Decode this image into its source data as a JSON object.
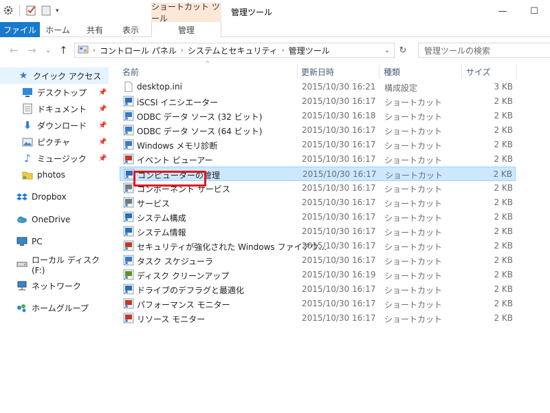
{
  "titlebar": {
    "context_tab": "ショートカット ツール",
    "window_title": "管理ツール",
    "minimize": "—",
    "maximize": "☐"
  },
  "ribbon": {
    "tabs": [
      "ファイル",
      "ホーム",
      "共有",
      "表示"
    ],
    "context_tab": "管理"
  },
  "nav": {
    "back": "←",
    "forward": "→",
    "dropdown": "⌄",
    "up": "↑",
    "breadcrumb": [
      "コントロール パネル",
      "システムとセキュリティ",
      "管理ツール"
    ],
    "search_placeholder": "管理ツールの検索"
  },
  "sidebar": {
    "items": [
      {
        "label": "クイック アクセス",
        "icon": "star-icon",
        "selected": true
      },
      {
        "label": "デスクトップ",
        "icon": "desktop-icon",
        "pinned": true
      },
      {
        "label": "ドキュメント",
        "icon": "documents-icon",
        "pinned": true
      },
      {
        "label": "ダウンロード",
        "icon": "download-icon",
        "pinned": true
      },
      {
        "label": "ピクチャ",
        "icon": "pictures-icon",
        "pinned": true
      },
      {
        "label": "ミュージック",
        "icon": "music-icon",
        "pinned": true
      },
      {
        "label": "photos",
        "icon": "folder-icon",
        "pinned": false
      },
      {
        "label": "Dropbox",
        "icon": "dropbox-icon"
      },
      {
        "label": "OneDrive",
        "icon": "onedrive-icon"
      },
      {
        "label": "PC",
        "icon": "pc-icon"
      },
      {
        "label": "ローカル ディスク (F:)",
        "icon": "drive-icon"
      },
      {
        "label": "ネットワーク",
        "icon": "network-icon"
      },
      {
        "label": "ホームグループ",
        "icon": "homegroup-icon"
      }
    ]
  },
  "columns": {
    "name": "名前",
    "modified": "更新日時",
    "type": "種類",
    "size": "サイズ"
  },
  "files": [
    {
      "name": "desktop.ini",
      "modified": "2015/10/30 16:21",
      "type": "構成設定",
      "size": "3 KB"
    },
    {
      "name": "iSCSI イニシエーター",
      "modified": "2015/10/30 16:17",
      "type": "ショートカット",
      "size": "2 KB"
    },
    {
      "name": "ODBC データ ソース (32 ビット)",
      "modified": "2015/10/30 16:18",
      "type": "ショートカット",
      "size": "2 KB"
    },
    {
      "name": "ODBC データ ソース (64 ビット)",
      "modified": "2015/10/30 16:17",
      "type": "ショートカット",
      "size": "2 KB"
    },
    {
      "name": "Windows メモリ診断",
      "modified": "2015/10/30 16:17",
      "type": "ショートカット",
      "size": "2 KB"
    },
    {
      "name": "イベント ビューアー",
      "modified": "2015/10/30 16:17",
      "type": "ショートカット",
      "size": "2 KB"
    },
    {
      "name": "コンピューターの管理",
      "modified": "2015/10/30 16:17",
      "type": "ショートカット",
      "size": "2 KB"
    },
    {
      "name": "コンポーネント サービス",
      "modified": "2015/10/30 16:17",
      "type": "ショートカット",
      "size": "2 KB"
    },
    {
      "name": "サービス",
      "modified": "2015/10/30 16:17",
      "type": "ショートカット",
      "size": "2 KB"
    },
    {
      "name": "システム構成",
      "modified": "2015/10/30 16:17",
      "type": "ショートカット",
      "size": "2 KB"
    },
    {
      "name": "システム情報",
      "modified": "2015/10/30 16:17",
      "type": "ショートカット",
      "size": "2 KB"
    },
    {
      "name": "セキュリティが強化された Windows ファイアウ...",
      "modified": "2015/10/30 16:17",
      "type": "ショートカット",
      "size": "2 KB"
    },
    {
      "name": "タスク スケジューラ",
      "modified": "2015/10/30 16:17",
      "type": "ショートカット",
      "size": "2 KB"
    },
    {
      "name": "ディスク クリーンアップ",
      "modified": "2015/10/30 16:19",
      "type": "ショートカット",
      "size": "2 KB"
    },
    {
      "name": "ドライブのデフラグと最適化",
      "modified": "2015/10/30 16:17",
      "type": "ショートカット",
      "size": "2 KB"
    },
    {
      "name": "パフォーマンス モニター",
      "modified": "2015/10/30 16:17",
      "type": "ショートカット",
      "size": "2 KB"
    },
    {
      "name": "リソース モニター",
      "modified": "2015/10/30 16:17",
      "type": "ショートカット",
      "size": "2 KB"
    }
  ],
  "selected_file": "コンピューターの管理",
  "colors": {
    "file_tab": "#1979ca",
    "context_tab": "#fde8d8",
    "selection": "#cce8ff",
    "highlight": "#e8141a"
  }
}
